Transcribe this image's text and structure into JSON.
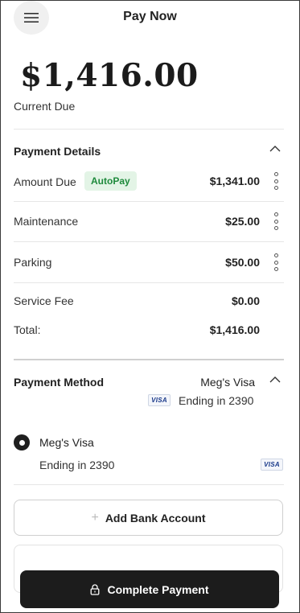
{
  "header": {
    "title": "Pay Now",
    "menu_icon": "hamburger-menu-icon"
  },
  "balance": {
    "amount": "$1,416.00",
    "caption": "Current Due"
  },
  "payment_details": {
    "title": "Payment Details",
    "collapse_icon": "chevron-up-icon",
    "rows": [
      {
        "label": "Amount Due",
        "badge": "AutoPay",
        "value": "$1,341.00"
      },
      {
        "label": "Maintenance",
        "value": "$25.00"
      },
      {
        "label": "Parking",
        "value": "$50.00"
      },
      {
        "label": "Service Fee",
        "value": "$0.00"
      },
      {
        "label": "Total:",
        "value": "$1,416.00"
      }
    ]
  },
  "payment_method": {
    "title": "Payment Method",
    "selected_name": "Meg's Visa",
    "selected_ending": "Ending in 2390",
    "card_brand": "VISA",
    "collapse_icon": "chevron-up-icon",
    "options": [
      {
        "name": "Meg's Visa",
        "ending": "Ending in 2390",
        "brand": "VISA",
        "selected": true
      }
    ]
  },
  "actions": {
    "add_bank": "Add Bank Account",
    "complete": "Complete Payment"
  },
  "colors": {
    "badge_bg": "#e3f4e6",
    "badge_text": "#1e8a3c",
    "primary_button": "#1c1c1c"
  }
}
